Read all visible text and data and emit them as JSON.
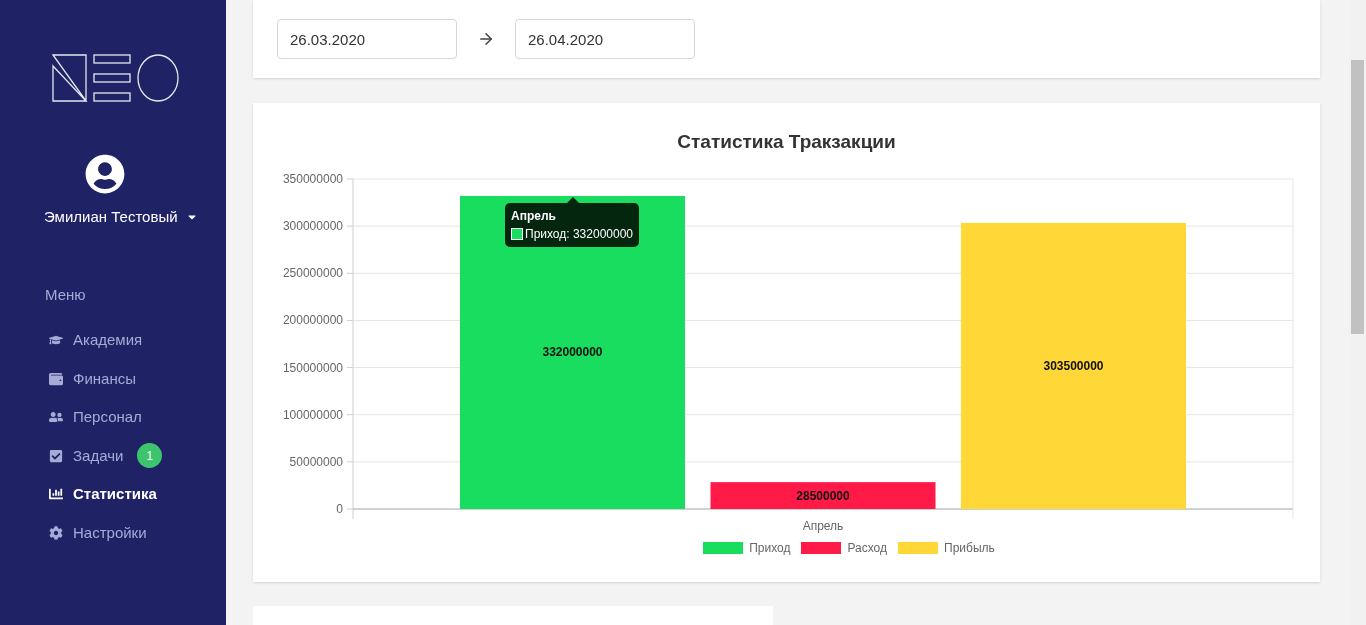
{
  "sidebar": {
    "user": {
      "name": "Эмилиан Тестовый"
    },
    "menu_title": "Меню",
    "items": [
      {
        "label": "Академия",
        "selected": false
      },
      {
        "label": "Финансы",
        "selected": false
      },
      {
        "label": "Персонал",
        "selected": false
      },
      {
        "label": "Задачи",
        "selected": false,
        "badge": "1"
      },
      {
        "label": "Статистика",
        "selected": true
      },
      {
        "label": "Настройки",
        "selected": false
      }
    ]
  },
  "date_range": {
    "from": "26.03.2020",
    "to": "26.04.2020"
  },
  "chart": {
    "tooltip": {
      "title": "Апрель",
      "text": "Приход: 332000000"
    },
    "chart_data": {
      "type": "bar",
      "title": "Статистика Тракзакции",
      "categories": [
        "Апрель"
      ],
      "series": [
        {
          "name": "Приход",
          "color": "#19dd5f",
          "values": [
            332000000
          ]
        },
        {
          "name": "Расход",
          "color": "#ff1a48",
          "values": [
            28500000
          ]
        },
        {
          "name": "Прибыль",
          "color": "#ffd737",
          "values": [
            303500000
          ]
        }
      ],
      "ylim": [
        0,
        350000000
      ],
      "yticks": [
        0,
        50000000,
        100000000,
        150000000,
        200000000,
        250000000,
        300000000,
        350000000
      ],
      "data_labels": true,
      "grid": true,
      "legend": true
    }
  }
}
